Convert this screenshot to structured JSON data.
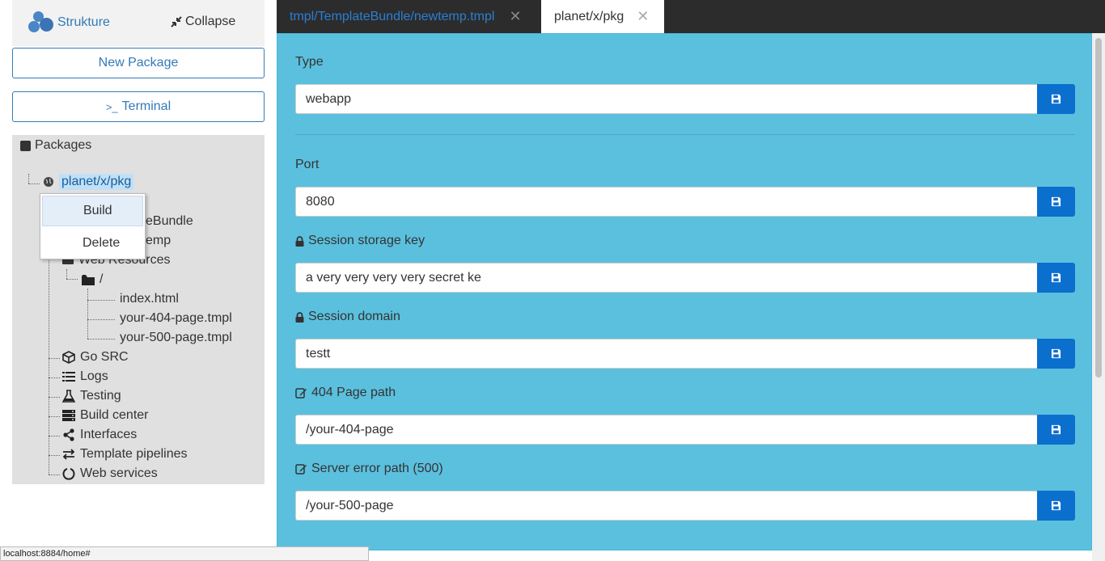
{
  "sidebar": {
    "brand": "Strukture",
    "collapse_label": "Collapse",
    "new_package_label": "New Package",
    "terminal_label": "Terminal",
    "terminal_prompt": ">_",
    "tree_title": "Packages",
    "selected_package": "planet/x/pkg",
    "hidden_items": [
      "eBundle",
      "emp"
    ],
    "web_resources": "Web Resources",
    "folder": "/",
    "files": [
      "index.html",
      "your-404-page.tmpl",
      "your-500-page.tmpl"
    ],
    "items": [
      "Go SRC",
      "Logs",
      "Testing",
      "Build center",
      "Interfaces",
      "Template pipelines",
      "Web services"
    ]
  },
  "context_menu": {
    "build": "Build",
    "delete": "Delete"
  },
  "tabs": [
    {
      "label": "tmpl/TemplateBundle/newtemp.tmpl",
      "active": false
    },
    {
      "label": "planet/x/pkg",
      "active": true
    }
  ],
  "form": {
    "type_label": "Type",
    "type_value": "webapp",
    "port_label": "Port",
    "port_value": "8080",
    "session_key_label": "Session storage key",
    "session_key_value": "a very very very very secret ke",
    "session_domain_label": "Session domain",
    "session_domain_value": "testt",
    "page404_label": "404 Page path",
    "page404_value": "/your-404-page",
    "error500_label": "Server error path (500)",
    "error500_value": "/your-500-page"
  },
  "status_url": "localhost:8884/home#",
  "colors": {
    "accent": "#337ab7",
    "panel": "#5bc0de",
    "save_button": "#0b6fce",
    "tabbar": "#2c2c2c"
  }
}
